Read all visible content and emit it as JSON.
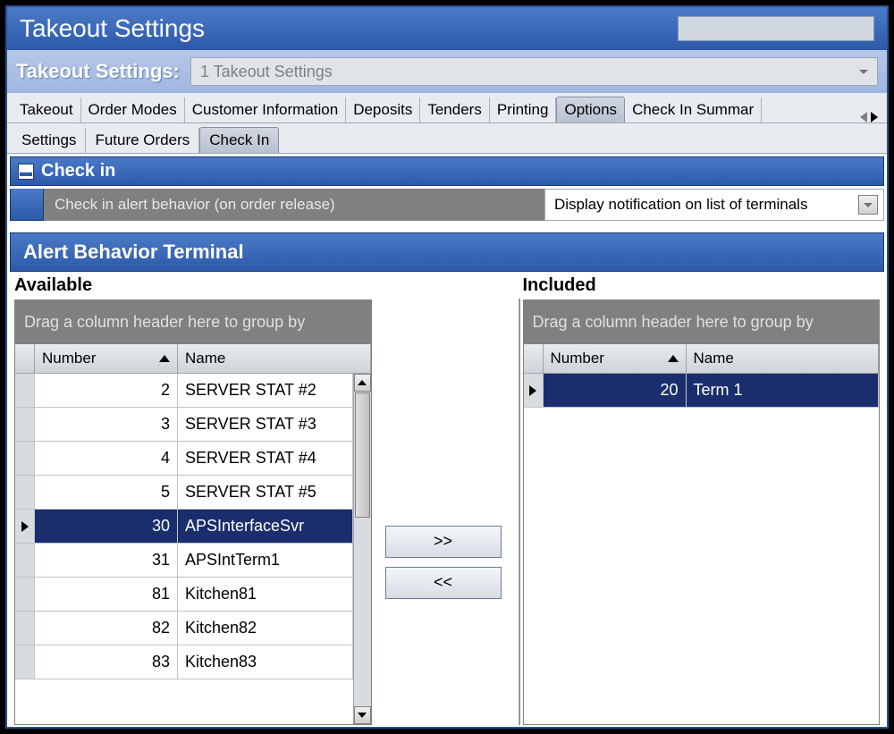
{
  "title": "Takeout Settings",
  "selector": {
    "label": "Takeout Settings:",
    "value": "1 Takeout Settings"
  },
  "main_tabs": {
    "items": [
      "Takeout",
      "Order Modes",
      "Customer Information",
      "Deposits",
      "Tenders",
      "Printing",
      "Options",
      "Check In Summar"
    ],
    "active_index": 6
  },
  "sub_tabs": {
    "items": [
      "Settings",
      "Future Orders",
      "Check In"
    ],
    "active_index": 2
  },
  "checkin": {
    "header": "Check in",
    "collapse_glyph": "▬",
    "field_label": "Check in alert behavior (on order release)",
    "field_value": "Display notification on list of terminals"
  },
  "alert_section": {
    "header": "Alert Behavior Terminal",
    "available_label": "Available",
    "included_label": "Included",
    "group_hint": "Drag a column header here to group by",
    "col_number": "Number",
    "col_name": "Name",
    "add_btn": ">>",
    "remove_btn": "<<"
  },
  "available_rows": [
    {
      "number": "2",
      "name": "SERVER STAT #2",
      "selected": false
    },
    {
      "number": "3",
      "name": "SERVER STAT #3",
      "selected": false
    },
    {
      "number": "4",
      "name": "SERVER STAT #4",
      "selected": false
    },
    {
      "number": "5",
      "name": "SERVER STAT #5",
      "selected": false
    },
    {
      "number": "30",
      "name": "APSInterfaceSvr",
      "selected": true
    },
    {
      "number": "31",
      "name": "APSIntTerm1",
      "selected": false
    },
    {
      "number": "81",
      "name": "Kitchen81",
      "selected": false
    },
    {
      "number": "82",
      "name": "Kitchen82",
      "selected": false
    },
    {
      "number": "83",
      "name": "Kitchen83",
      "selected": false
    }
  ],
  "included_rows": [
    {
      "number": "20",
      "name": "Term 1",
      "selected": true
    }
  ]
}
